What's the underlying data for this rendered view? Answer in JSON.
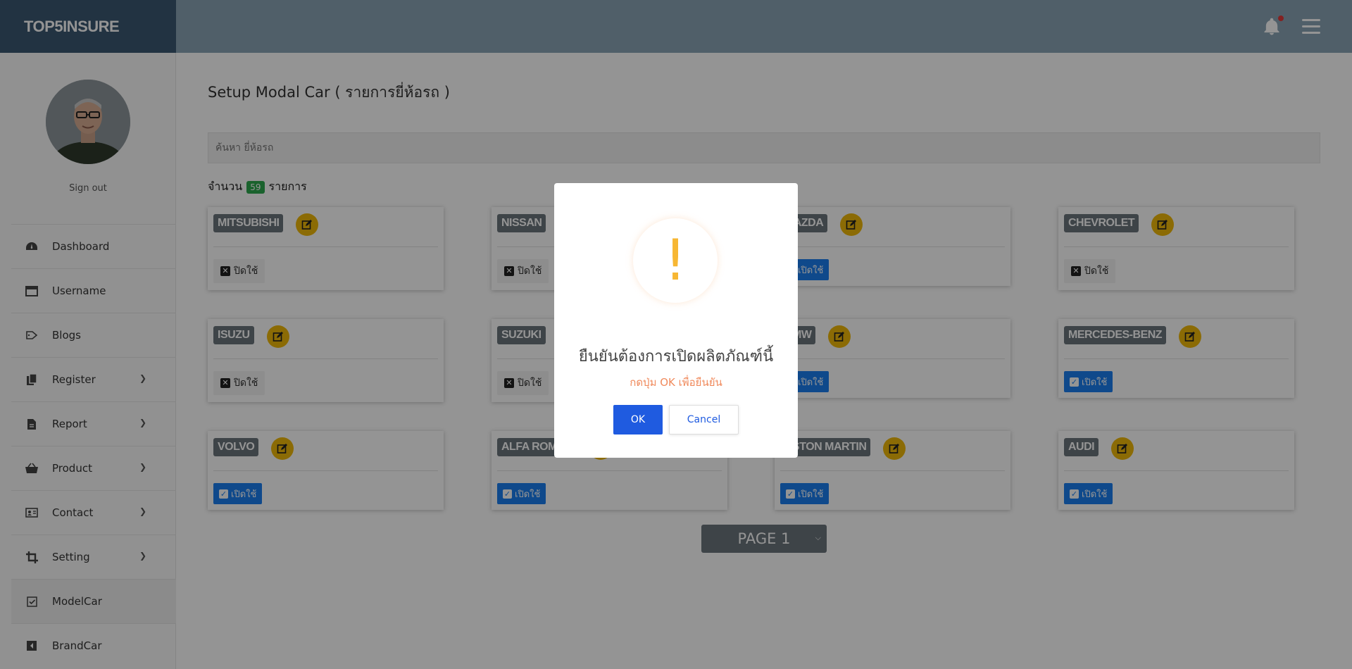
{
  "brand": "TOP5INSURE",
  "icons": {
    "notifications": "bell-icon",
    "menu": "hamburger-icon"
  },
  "sidebar": {
    "sign_out": "Sign out",
    "items": [
      {
        "label": "Dashboard",
        "icon": "dashboard-icon"
      },
      {
        "label": "Username",
        "icon": "window-icon"
      },
      {
        "label": "Blogs",
        "icon": "blog-icon"
      },
      {
        "label": "Register",
        "icon": "copy-icon",
        "chevron": true
      },
      {
        "label": "Report",
        "icon": "file-icon",
        "chevron": true
      },
      {
        "label": "Product",
        "icon": "basket-icon",
        "chevron": true
      },
      {
        "label": "Contact",
        "icon": "id-card-icon",
        "chevron": true
      },
      {
        "label": "Setting",
        "icon": "crop-icon",
        "chevron": true
      },
      {
        "label": "ModelCar",
        "icon": "checkbox-icon",
        "active": true
      },
      {
        "label": "BrandCar",
        "icon": "caret-left-icon"
      }
    ]
  },
  "main": {
    "title": "Setup Modal Car ( รายการยี่ห้อรถ )",
    "search_placeholder": "ค้นหา ยี่ห้อรถ",
    "count_prefix": "จำนวน",
    "count": "59",
    "count_suffix": "รายการ",
    "cards": [
      {
        "name": "MITSUBISHI",
        "status": "ปิดใช้",
        "enabled": false
      },
      {
        "name": "NISSAN",
        "status": "ปิดใช้",
        "enabled": false
      },
      {
        "name": "MAZDA",
        "status": "เปิดใช้",
        "enabled": true
      },
      {
        "name": "CHEVROLET",
        "status": "ปิดใช้",
        "enabled": false
      },
      {
        "name": "ISUZU",
        "status": "ปิดใช้",
        "enabled": false
      },
      {
        "name": "SUZUKI",
        "status": "ปิดใช้",
        "enabled": false
      },
      {
        "name": "BMW",
        "status": "เปิดใช้",
        "enabled": true
      },
      {
        "name": "MERCEDES-BENZ",
        "status": "เปิดใช้",
        "enabled": true
      },
      {
        "name": "VOLVO",
        "status": "เปิดใช้",
        "enabled": true
      },
      {
        "name": "ALFA ROMEO",
        "status": "เปิดใช้",
        "enabled": true
      },
      {
        "name": "ASTON MARTIN",
        "status": "เปิดใช้",
        "enabled": true
      },
      {
        "name": "AUDI",
        "status": "เปิดใช้",
        "enabled": true
      }
    ],
    "pager": "PAGE 1"
  },
  "modal": {
    "icon": "!",
    "title": "ยืนยันต้องการเปิดผลิตภัณฑ์นี้",
    "text": "กดปุ่ม OK เพื่อยืนยัน",
    "ok_label": "OK",
    "cancel_label": "Cancel"
  },
  "colors": {
    "topbar": "#8ba4b6",
    "brand_bg": "#3b5872",
    "enable_button": "#1a7ff0",
    "edit_button": "#f0b80a",
    "brand_badge": "#6c757d",
    "count_badge": "#2eaa4f",
    "warning": "#f7b733",
    "ok_button": "#1f5be0"
  }
}
